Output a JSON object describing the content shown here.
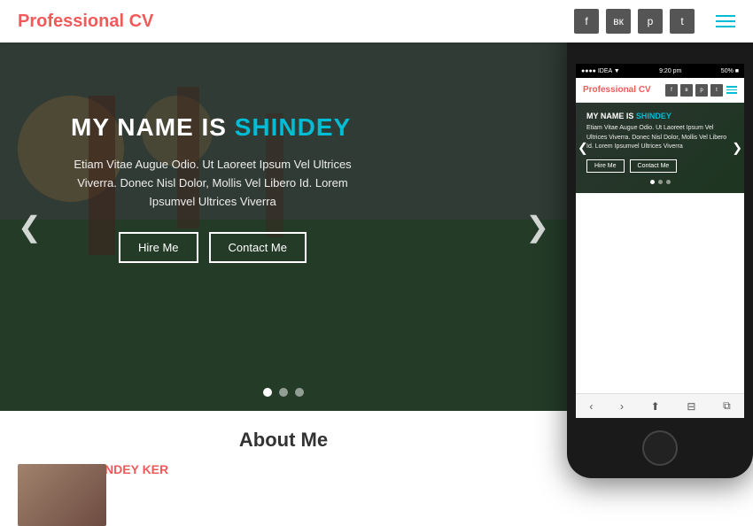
{
  "navbar": {
    "logo_text": "Professional ",
    "logo_highlight": "CV",
    "social_icons": [
      "f",
      "v",
      "p",
      "t"
    ],
    "social_labels": [
      "facebook-icon",
      "vk-icon",
      "pinterest-icon",
      "twitter-icon"
    ]
  },
  "hero": {
    "title_prefix": "MY NAME IS ",
    "title_highlight": "SHINDEY",
    "subtitle": "Etiam Vitae Augue Odio. Ut Laoreet Ipsum Vel Ultrices Viverra. Donec Nisl Dolor, Mollis Vel Libero Id. Lorem Ipsumvel Ultrices Viverra",
    "btn_hire": "Hire Me",
    "btn_contact": "Contact Me",
    "arrow_left": "❮",
    "arrow_right": "❯",
    "dots": [
      true,
      false,
      false
    ]
  },
  "below_hero": {
    "about_title": "About Me",
    "about_sub": "HI, I AM SHINDEY KER"
  },
  "phone": {
    "status_bar": {
      "left": "●●●● IDEA ▼",
      "center": "9:20 pm",
      "right": "50% ■"
    },
    "logo_text": "Professional ",
    "logo_highlight": "CV",
    "hero_title_prefix": "MY NAME IS ",
    "hero_title_highlight": "SHINDEY",
    "hero_text": "Etiam Vitae Augue Odio. Ut Laoreet Ipsum Vel Ultrices Viverra. Donec Nisl Dolor, Mollis Vel Libero Id. Lorem Ipsumvel Ultrices Viverra",
    "btn_hire": "Hire Me",
    "btn_contact": "Contact Me"
  }
}
